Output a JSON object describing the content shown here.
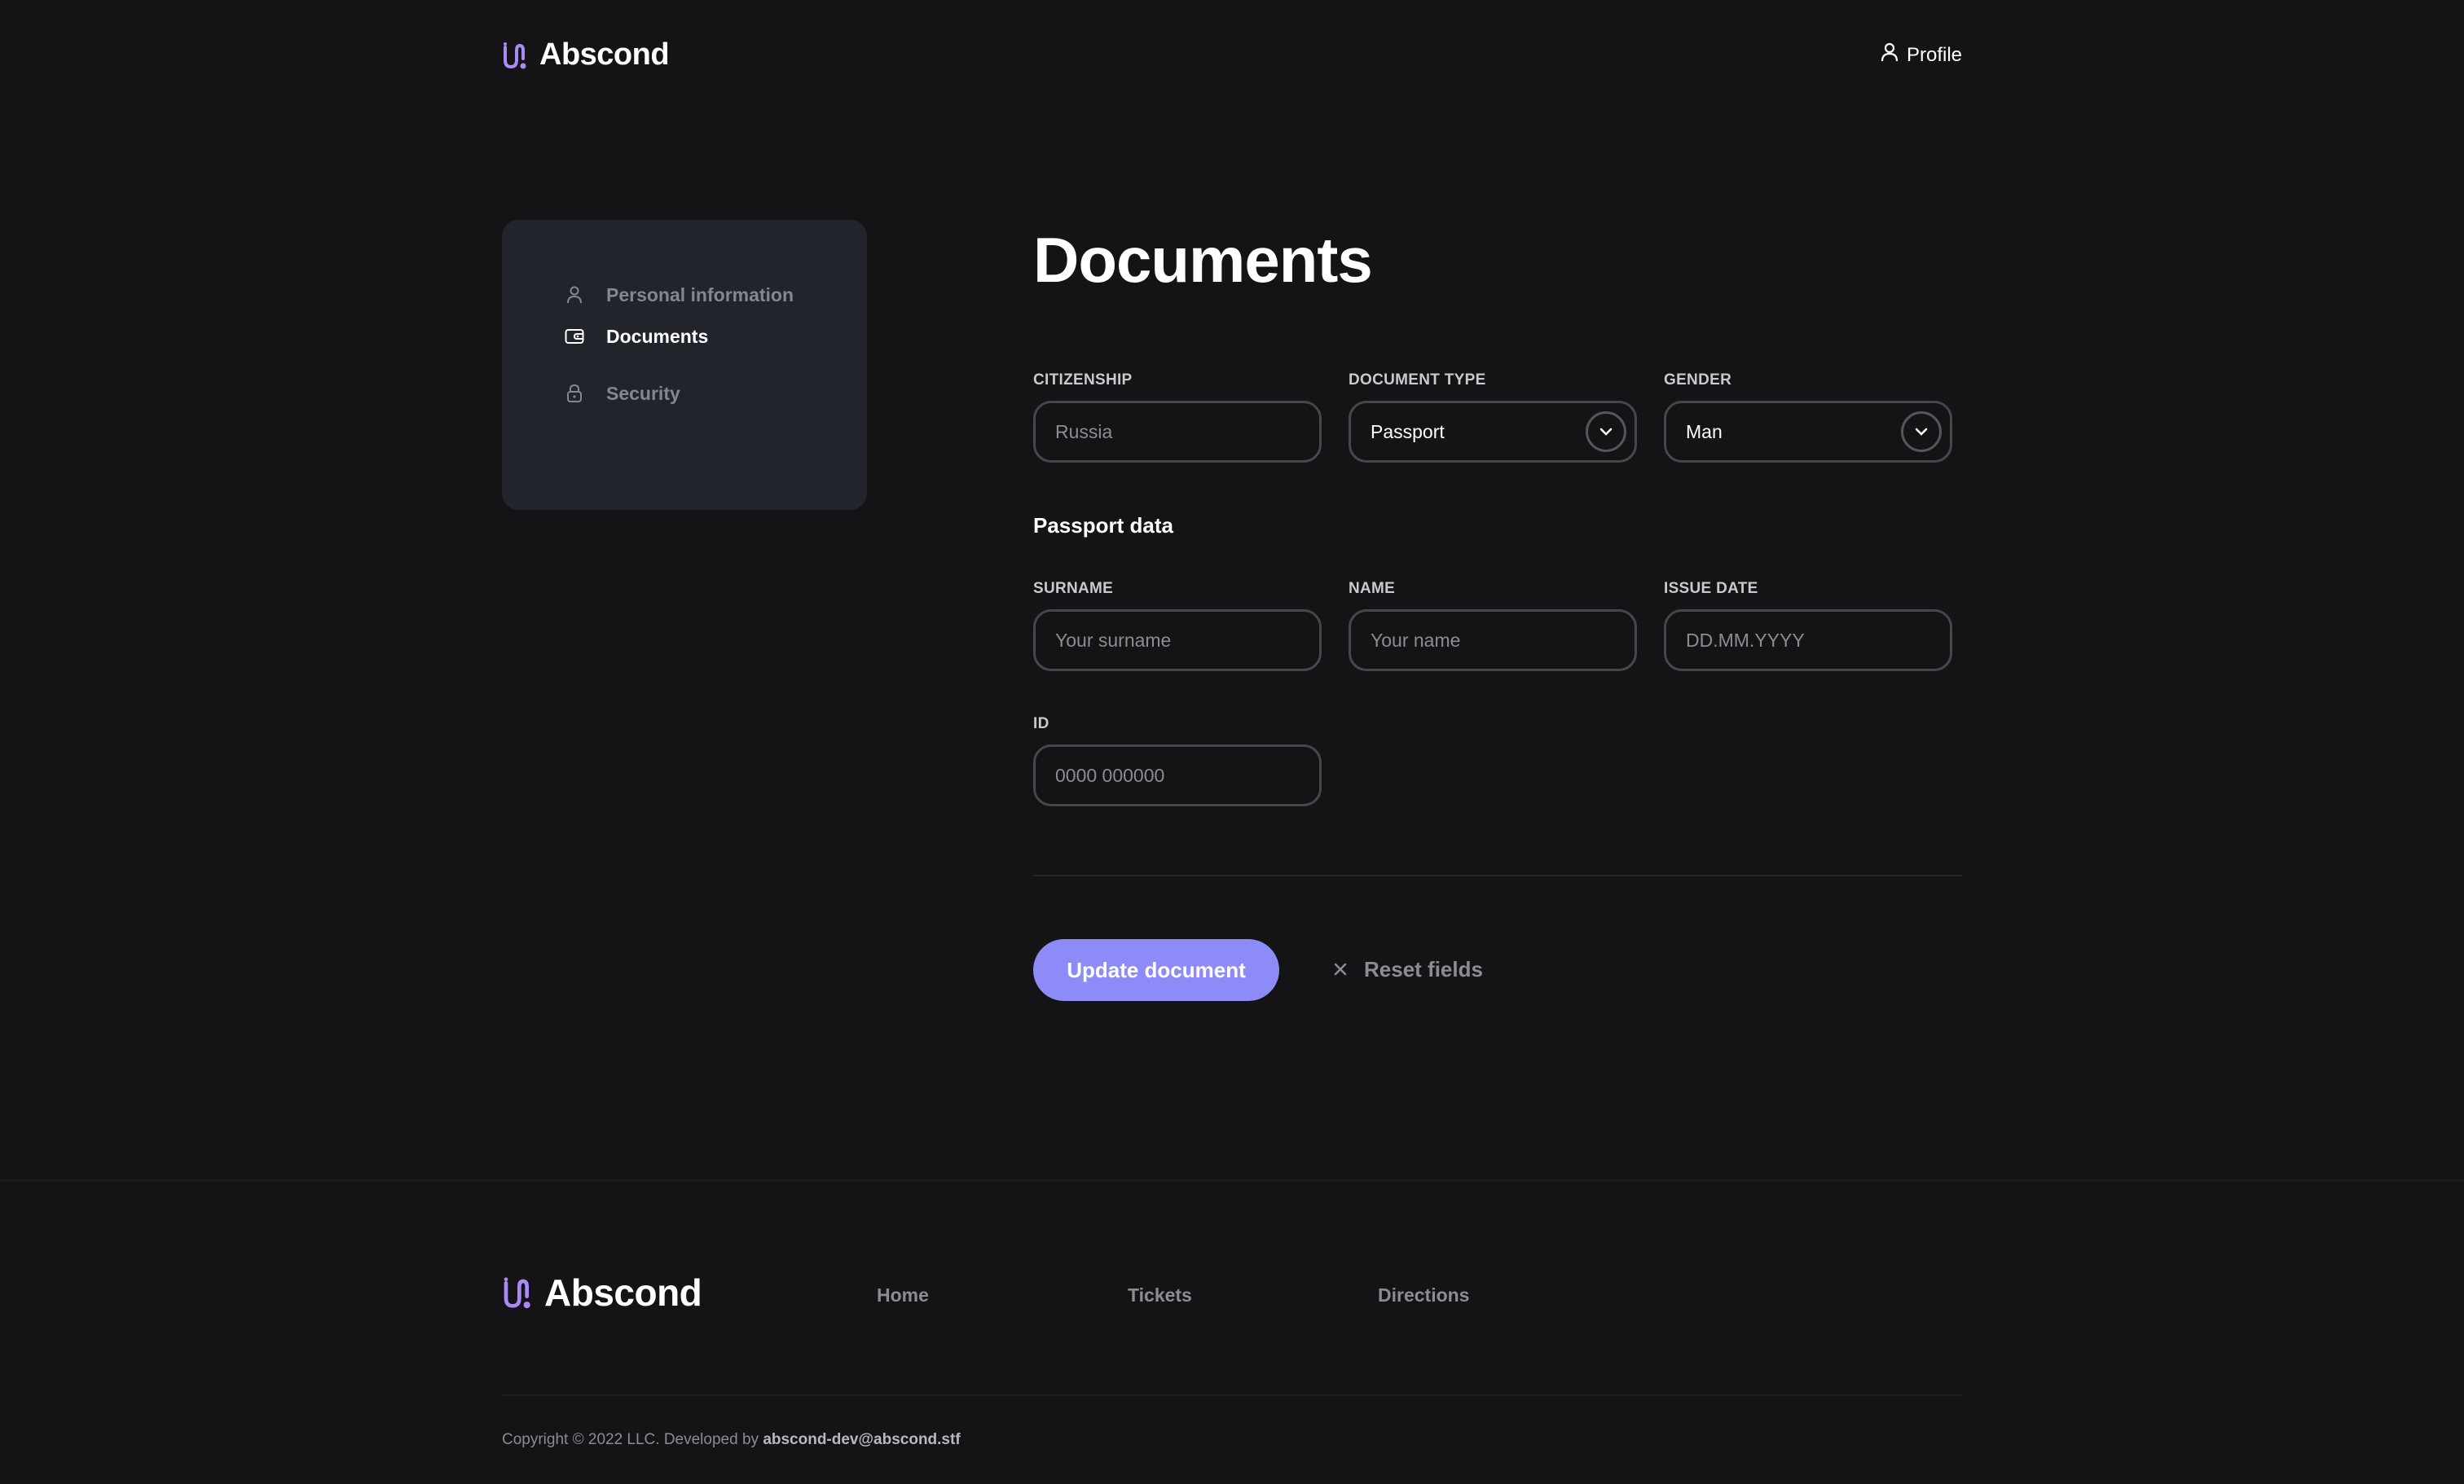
{
  "header": {
    "brand": "Abscond",
    "profile_label": "Profile"
  },
  "sidebar": {
    "items": [
      {
        "label": "Personal information",
        "icon": "user-icon",
        "active": false
      },
      {
        "label": "Documents",
        "icon": "wallet-icon",
        "active": true
      },
      {
        "label": "Security",
        "icon": "lock-icon",
        "active": false
      }
    ]
  },
  "main": {
    "title": "Documents",
    "citizenship": {
      "label": "CITIZENSHIP",
      "placeholder": "Russia"
    },
    "document_type": {
      "label": "DOCUMENT TYPE",
      "value": "Passport"
    },
    "gender": {
      "label": "GENDER",
      "value": "Man"
    },
    "passport_heading": "Passport data",
    "surname": {
      "label": "SURNAME",
      "placeholder": "Your surname"
    },
    "name": {
      "label": "NAME",
      "placeholder": "Your name"
    },
    "issue_date": {
      "label": "ISSUE DATE",
      "placeholder": "DD.MM.YYYY"
    },
    "id": {
      "label": "ID",
      "placeholder": "0000 000000"
    },
    "update_button": "Update document",
    "reset_button": "Reset fields"
  },
  "footer": {
    "brand": "Abscond",
    "nav": [
      "Home",
      "Tickets",
      "Directions"
    ],
    "copyright_prefix": "Copyright © 2022 LLC. Developed by",
    "developer_email": "abscond-dev@abscond.stf"
  },
  "colors": {
    "background": "#141417",
    "card": "#22242c",
    "accent": "#8d8bf7",
    "logo_accent": "#a98bf5",
    "muted_text": "#8b8c94"
  }
}
